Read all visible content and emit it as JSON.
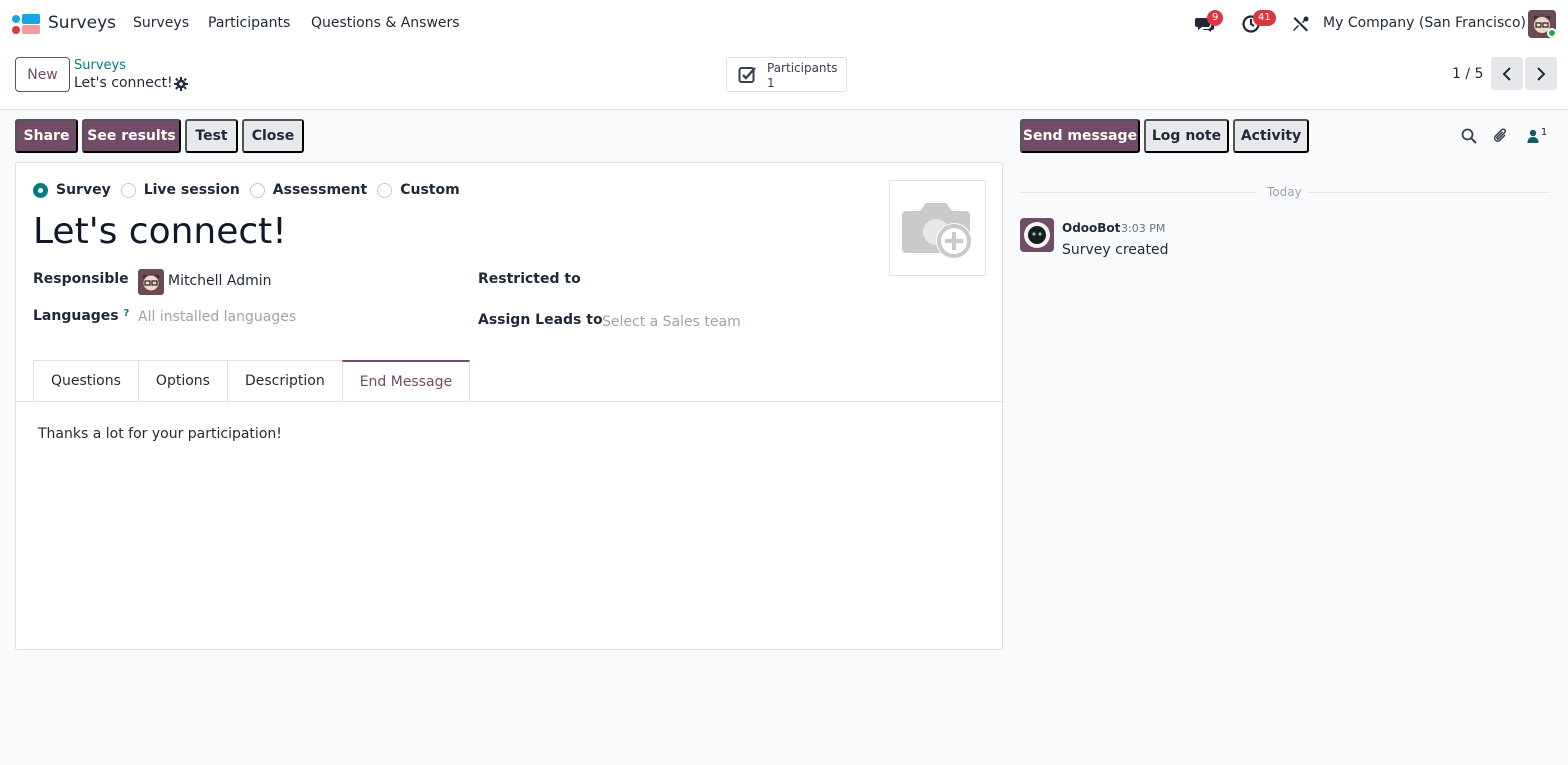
{
  "navbar": {
    "app_name": "Surveys",
    "menu": [
      "Surveys",
      "Participants",
      "Questions & Answers"
    ],
    "messages_count": "9",
    "activities_count": "41",
    "company": "My Company (San Francisco)"
  },
  "control": {
    "new_label": "New",
    "breadcrumb_parent": "Surveys",
    "breadcrumb_current": "Let's connect!",
    "smart_button": {
      "label": "Participants",
      "value": "1"
    },
    "pager": "1 / 5"
  },
  "actions": {
    "share": "Share",
    "see_results": "See results",
    "test": "Test",
    "close": "Close"
  },
  "chatter_actions": {
    "send_message": "Send message",
    "log_note": "Log note",
    "activity": "Activity",
    "followers_count": "1"
  },
  "form": {
    "survey_types": [
      {
        "label": "Survey",
        "selected": true
      },
      {
        "label": "Live session",
        "selected": false
      },
      {
        "label": "Assessment",
        "selected": false
      },
      {
        "label": "Custom",
        "selected": false
      }
    ],
    "title": "Let's connect!",
    "responsible_label": "Responsible",
    "responsible_value": "Mitchell Admin",
    "languages_label": "Languages",
    "languages_help": "?",
    "languages_placeholder": "All installed languages",
    "restricted_label": "Restricted to",
    "assign_leads_label": "Assign Leads to",
    "assign_leads_placeholder": "Select a Sales team",
    "tabs": [
      "Questions",
      "Options",
      "Description",
      "End Message"
    ],
    "active_tab": "End Message",
    "end_message": "Thanks a lot for your participation!"
  },
  "chatter": {
    "date_separator": "Today",
    "author": "OdooBot",
    "time": "3:03 PM",
    "body": "Survey created"
  },
  "colors": {
    "primary": "#714b67",
    "accent": "#017e84",
    "badge": "#d9383f"
  }
}
